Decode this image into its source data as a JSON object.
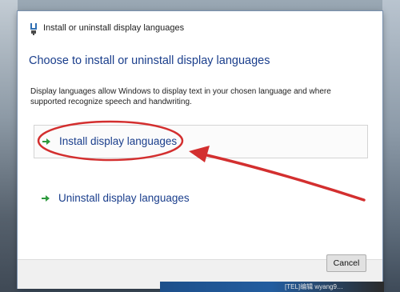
{
  "window": {
    "title": "Install or uninstall display languages"
  },
  "main": {
    "heading": "Choose to install or uninstall display languages",
    "description": "Display languages allow Windows to display text in your chosen language and where supported recognize speech and handwriting.",
    "options": [
      {
        "label": "Install display languages",
        "icon": "green-arrow-icon"
      },
      {
        "label": "Uninstall display languages",
        "icon": "green-arrow-icon"
      }
    ]
  },
  "footer": {
    "cancel_label": "Cancel"
  },
  "taskbar": {
    "text": "[TEL]编辑 wyang9…"
  },
  "annotation": {
    "color": "#d32f2f"
  }
}
